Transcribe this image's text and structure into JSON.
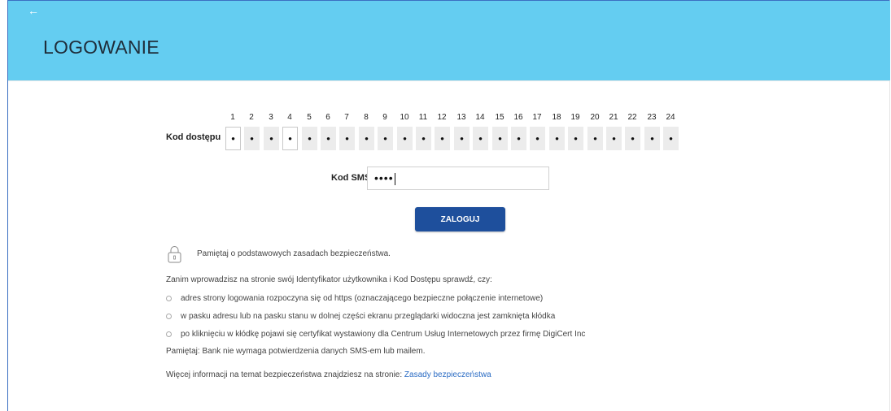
{
  "header": {
    "back_icon": "arrow-left-icon",
    "title": "LOGOWANIE",
    "color": "#64cdf1"
  },
  "access_code": {
    "label": "Kod dostępu",
    "positions": [
      "1",
      "2",
      "3",
      "4",
      "5",
      "6",
      "7",
      "8",
      "9",
      "10",
      "11",
      "12",
      "13",
      "14",
      "15",
      "16",
      "17",
      "18",
      "19",
      "20",
      "21",
      "22",
      "23",
      "24"
    ],
    "cells": [
      "•",
      "•",
      "•",
      "•",
      "•",
      "•",
      "•",
      "•",
      "•",
      "•",
      "•",
      "•",
      "•",
      "•",
      "•",
      "•",
      "•",
      "•",
      "•",
      "•",
      "•",
      "•",
      "•",
      "•"
    ],
    "active_positions": [
      1,
      4
    ]
  },
  "sms": {
    "label": "Kod SMS",
    "value": "••••"
  },
  "login_button": {
    "label": "ZALOGUJ",
    "color": "#1e4f9c"
  },
  "security": {
    "lock_icon": "lock-icon",
    "reminder": "Pamiętaj o podstawowych zasadach bezpieczeństwa.",
    "intro": "Zanim wprowadzisz na stronie swój Identyfikator użytkownika i Kod Dostępu sprawdź, czy:",
    "items": [
      "adres strony logowania rozpoczyna się od https (oznaczającego bezpieczne połączenie internetowe)",
      "w pasku adresu lub na pasku stanu w dolnej części ekranu przeglądarki widoczna jest zamknięta kłódka",
      "po kliknięciu w kłódkę pojawi się certyfikat wystawiony dla Centrum Usług Internetowych przez firmę DigiCert Inc"
    ],
    "note": "Pamiętaj: Bank nie wymaga potwierdzenia danych SMS-em lub mailem.",
    "more_text": "Więcej informacji na temat bezpieczeństwa znajdziesz na stronie: ",
    "more_link": "Zasady bezpieczeństwa"
  }
}
